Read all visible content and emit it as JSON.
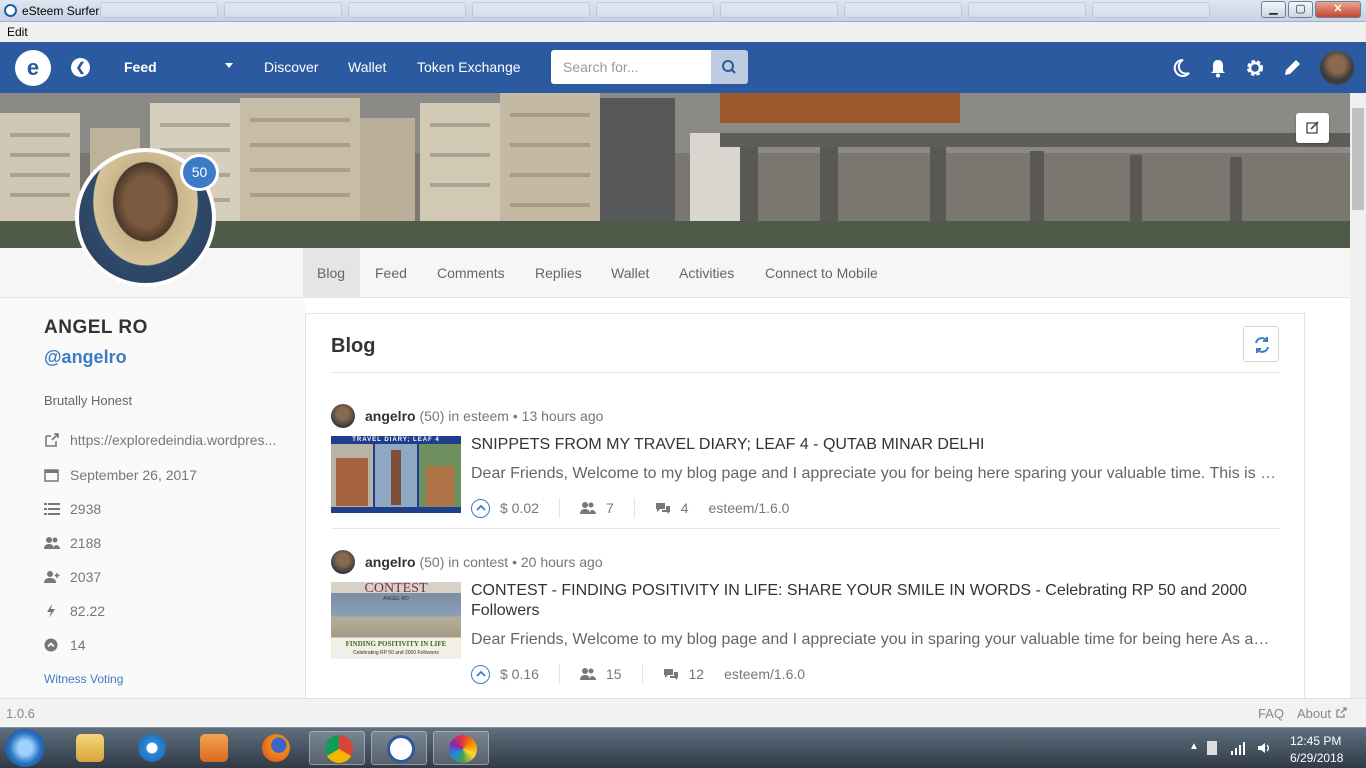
{
  "window": {
    "title": "eSteem Surfer",
    "menu_edit": "Edit",
    "min_label": "▁",
    "max_label": "▢",
    "close_label": "✕"
  },
  "navbar": {
    "feed_label": "Feed",
    "links": [
      "Discover",
      "Wallet",
      "Token Exchange"
    ],
    "search_placeholder": "Search for..."
  },
  "profile": {
    "reputation": "50",
    "display_name": "ANGEL RO",
    "handle": "@angelro",
    "about": "Brutally Honest",
    "website": "https://exploredeindia.wordpres...",
    "joined": "September 26, 2017",
    "post_count": "2938",
    "followers": "2188",
    "following": "2037",
    "voting_power": "82.22",
    "vote_value": "14",
    "witness_voting": "Witness Voting"
  },
  "tabs": [
    "Blog",
    "Feed",
    "Comments",
    "Replies",
    "Wallet",
    "Activities",
    "Connect to Mobile"
  ],
  "main": {
    "title": "Blog",
    "posts": [
      {
        "author": "angelro",
        "rep": "(50)",
        "in_label": "in",
        "category": "esteem",
        "time": "13 hours ago",
        "title": "SNIPPETS FROM MY TRAVEL DIARY; LEAF 4 - QUTAB MINAR DELHI",
        "snippet": "Dear Friends, Welcome to my blog page and I appreciate you for being here sparing your valuable time. This is …",
        "payout": "$ 0.02",
        "voters": "7",
        "comments": "4",
        "app": "esteem/1.6.0",
        "thumb_text": "TRAVEL DIARY; LEAF 4"
      },
      {
        "author": "angelro",
        "rep": "(50)",
        "in_label": "in",
        "category": "contest",
        "time": "20 hours ago",
        "title": "CONTEST - FINDING POSITIVITY IN LIFE: SHARE YOUR SMILE IN WORDS - Celebrating RP 50 and 2000 Followers",
        "snippet": "Dear Friends, Welcome to my blog page and I appreciate you in sparing your valuable time for being here As a…",
        "payout": "$ 0.16",
        "voters": "15",
        "comments": "12",
        "app": "esteem/1.6.0",
        "thumb_title": "CONTEST",
        "thumb_sub": "ANGEL RO",
        "thumb_caption": "FINDING POSITIVITY IN LIFE",
        "thumb_caption2": "Celebrating RP 50 and 2000 Followers"
      }
    ]
  },
  "footer": {
    "version": "1.0.6",
    "faq": "FAQ",
    "about": "About"
  },
  "taskbar": {
    "time": "12:45 PM",
    "date": "6/29/2018"
  },
  "colors": {
    "nav": "#2c5aa0",
    "accent": "#3e7bc6"
  }
}
